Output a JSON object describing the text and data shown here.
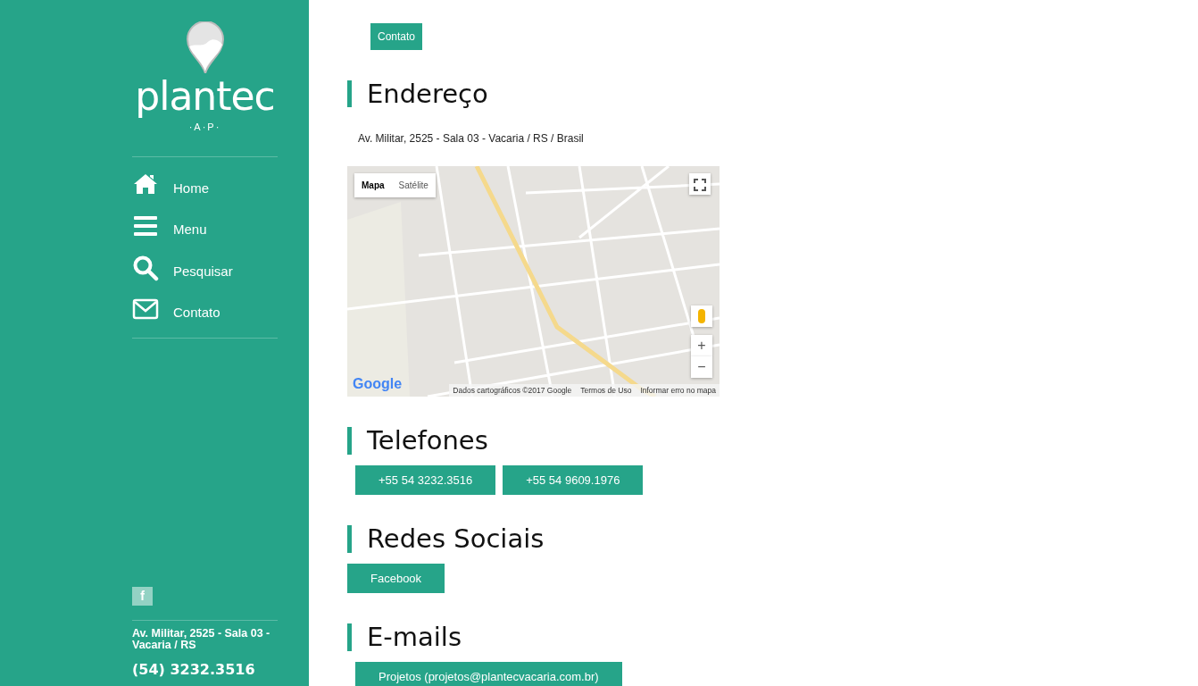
{
  "sidebar": {
    "logo": {
      "name": "plantec",
      "tagline": "·A·P·"
    },
    "nav": [
      {
        "label": "Home",
        "kind": "home"
      },
      {
        "label": "Menu",
        "kind": "menu"
      },
      {
        "label": "Pesquisar",
        "kind": "search"
      },
      {
        "label": "Contato",
        "kind": "mail"
      }
    ],
    "social": [
      {
        "label": "f"
      }
    ],
    "address": "Av. Militar, 2525 - Sala 03 - Vacaria / RS",
    "phone": "(54) 3232.3516"
  },
  "breadcrumb": "Contato",
  "sections": [
    {
      "title": "Endereço",
      "kind": "address",
      "text": "Av. Militar, 2525 - Sala 03 - Vacaria / RS / Brasil",
      "map": {
        "types": [
          {
            "label": "Mapa",
            "selected": true
          },
          {
            "label": "Satélite",
            "selected": false
          }
        ],
        "zoom_in": "+",
        "zoom_out": "−",
        "logo": "Google",
        "attribution": [
          "Dados cartográficos ©2017 Google",
          "Termos de Uso",
          "Informar erro no mapa"
        ]
      }
    },
    {
      "title": "Telefones",
      "kind": "buttons",
      "buttons": [
        "+55 54 3232.3516",
        "+55 54 9609.1976"
      ]
    },
    {
      "title": "Redes Sociais",
      "kind": "buttons",
      "buttons": [
        "Facebook"
      ]
    },
    {
      "title": "E-mails",
      "kind": "buttons",
      "buttons": [
        "Projetos (projetos@plantecvacaria.com.br)"
      ]
    }
  ]
}
